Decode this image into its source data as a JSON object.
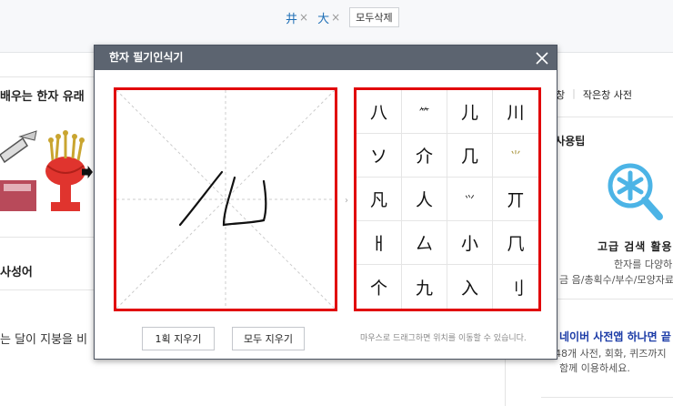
{
  "recent": {
    "chips": [
      {
        "char": "井"
      },
      {
        "char": "大"
      }
    ],
    "remove_glyph": "×",
    "clear_all": "모두삭제"
  },
  "background": {
    "heading1": "배우는 한자 유래",
    "heading2": "사성어",
    "body_text": "는 달이 지붕을 비",
    "right_links": [
      "창",
      "작은창 사전"
    ],
    "tips_title": "선 사용팁",
    "advanced_search_title": "고급 검색 활용",
    "advanced_line1": "한자를 다양하게",
    "advanced_line2": "금 음/총획수/부수/모양자료",
    "app_title": "네이버 사전앱 하나면 끝",
    "app_line1": "48개 사전, 회화, 퀴즈까지",
    "app_line2": "함께 이용하세요."
  },
  "modal": {
    "title": "한자 필기인식기",
    "close_icon": "close-icon",
    "candidates": [
      "八",
      "⺮",
      "儿",
      "川",
      "ソ",
      "介",
      "几",
      "⺌",
      "凡",
      "人",
      "⺍",
      "丌",
      "ㅐ",
      "厶",
      "小",
      "𠘨",
      "个",
      "九",
      "入",
      "刂"
    ],
    "btn_undo_stroke": "1획 지우기",
    "btn_clear_all": "모두 지우기",
    "hint": "마우스로 드래그하면 위치를 이동할 수 있습니다."
  },
  "colors": {
    "highlight": "#e1060a",
    "modal_header": "#5c6470",
    "link_blue": "#1f6fb6"
  }
}
